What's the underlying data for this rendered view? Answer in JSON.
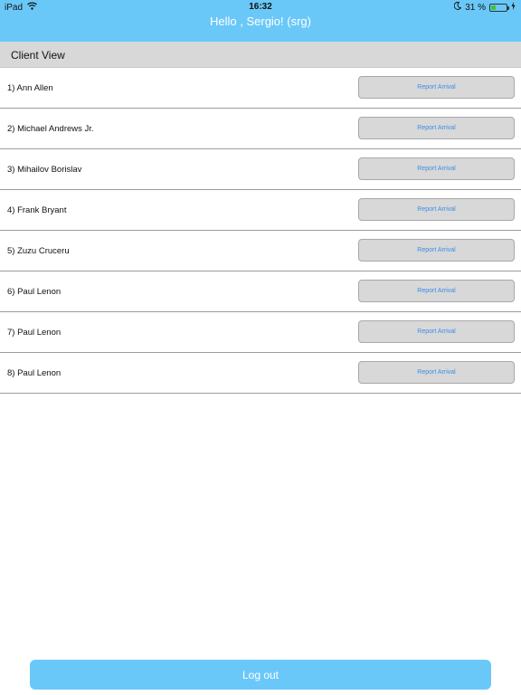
{
  "status_bar": {
    "device": "iPad",
    "time": "16:32",
    "battery_percent": "31 %",
    "battery_level": 0.31
  },
  "header": {
    "greeting": "Hello , Sergio! (srg)",
    "background_color": "#6ac8f8"
  },
  "section": {
    "title": "Client View"
  },
  "clients": [
    {
      "name": "1) Ann Allen",
      "action": "Report Arrival"
    },
    {
      "name": "2) Michael Andrews Jr.",
      "action": "Report Arrival"
    },
    {
      "name": "3) Mihailov Borislav",
      "action": "Report Arrival"
    },
    {
      "name": "4) Frank Bryant",
      "action": "Report Arrival"
    },
    {
      "name": "5) Zuzu Cruceru",
      "action": "Report Arrival"
    },
    {
      "name": "6) Paul Lenon",
      "action": "Report Arrival"
    },
    {
      "name": "7) Paul Lenon",
      "action": "Report Arrival"
    },
    {
      "name": "8) Paul Lenon",
      "action": "Report Arrival"
    }
  ],
  "footer": {
    "logout_label": "Log out"
  },
  "colors": {
    "accent": "#6ac8f8",
    "link": "#3a8ee6"
  },
  "icons": [
    "wifi-icon",
    "moon-icon",
    "battery-icon",
    "charging-icon"
  ]
}
